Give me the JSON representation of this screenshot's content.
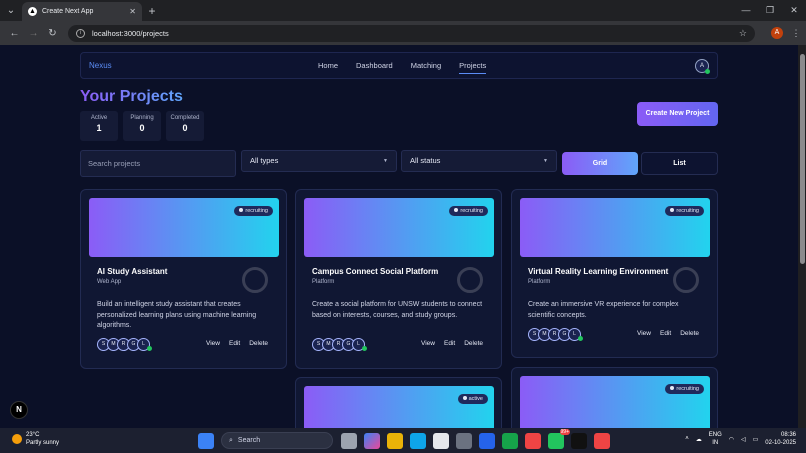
{
  "browser": {
    "tab_title": "Create Next App",
    "tab_favicon": "▲",
    "url": "localhost:3000/projects",
    "profile_initial": "A"
  },
  "nav": {
    "brand": "Nexus",
    "links": [
      "Home",
      "Dashboard",
      "Matching",
      "Projects"
    ],
    "active": "Projects",
    "avatar_initial": "A"
  },
  "page": {
    "title": "Your Projects",
    "stats": [
      {
        "label": "Active",
        "value": "1"
      },
      {
        "label": "Planning",
        "value": "0"
      },
      {
        "label": "Completed",
        "value": "0"
      }
    ],
    "create_button": "Create New Project",
    "search_placeholder": "Search projects",
    "type_filter": "All types",
    "status_filter": "All status",
    "grid_label": "Grid",
    "list_label": "List"
  },
  "projects": [
    {
      "status": "recruiting",
      "title": "AI Study Assistant",
      "type": "Web App",
      "description": "Build an intelligent study assistant that creates personalized learning plans using machine learning algorithms.",
      "avatars": [
        "S",
        "M",
        "R",
        "G",
        "L"
      ],
      "actions": [
        "View",
        "Edit",
        "Delete"
      ]
    },
    {
      "status": "recruiting",
      "title": "Campus Connect Social Platform",
      "type": "Platform",
      "description": "Create a social platform for UNSW students to connect based on interests, courses, and study groups.",
      "avatars": [
        "S",
        "M",
        "R",
        "G",
        "L"
      ],
      "actions": [
        "View",
        "Edit",
        "Delete"
      ]
    },
    {
      "status": "recruiting",
      "title": "Virtual Reality Learning Environment",
      "type": "Platform",
      "description": "Create an immersive VR experience for complex scientific concepts.",
      "avatars": [
        "S",
        "M",
        "R",
        "G",
        "L"
      ],
      "actions": [
        "View",
        "Edit",
        "Delete"
      ]
    },
    {
      "status": "active"
    },
    {
      "status": "recruiting"
    }
  ],
  "next_badge": "N",
  "taskbar": {
    "temp": "23°C",
    "weather": "Partly sunny",
    "search": "Search",
    "lang1": "ENG",
    "lang2": "IN",
    "time": "08:36",
    "date": "02-10-2025",
    "notif_badge": "99+"
  }
}
